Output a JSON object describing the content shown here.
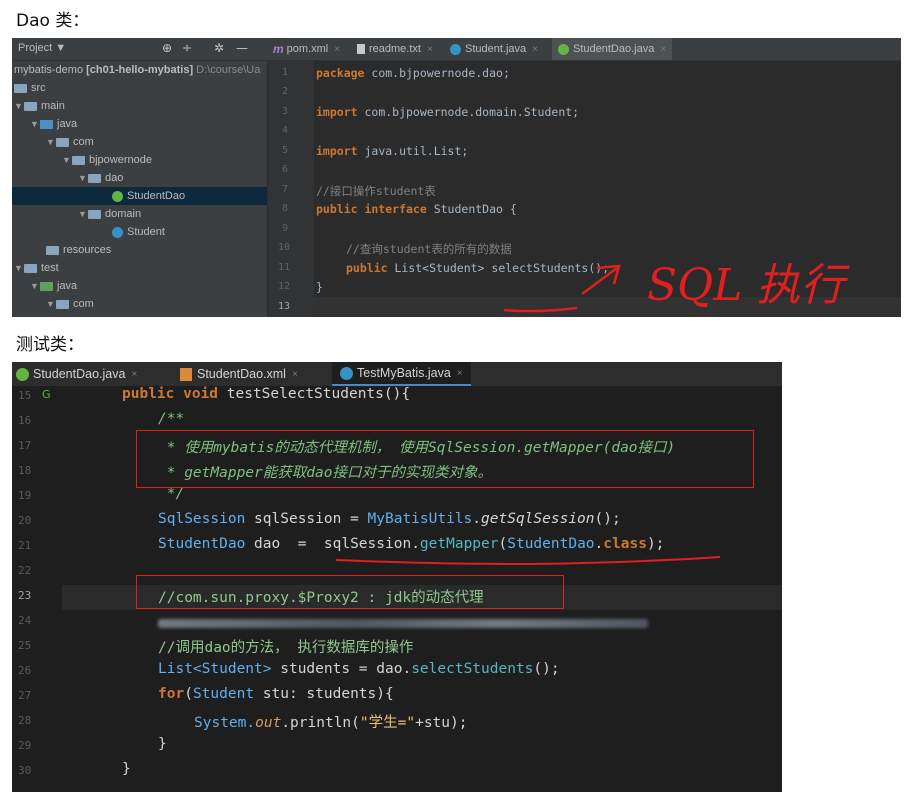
{
  "captions": {
    "dao": "Dao 类：",
    "test": "测试类："
  },
  "ide1": {
    "project_label": "Project ▼",
    "tabs": [
      {
        "label": "pom.xml",
        "icon": "m"
      },
      {
        "label": "readme.txt",
        "icon": "txt"
      },
      {
        "label": "Student.java",
        "icon": "class"
      },
      {
        "label": "StudentDao.java",
        "icon": "interface"
      }
    ],
    "tree": {
      "root": "mybatis-demo",
      "root_module": "[ch01-hello-mybatis]",
      "root_path": "D:\\course\\Ua",
      "items": [
        "src",
        "main",
        "java",
        "com",
        "bjpowernode",
        "dao",
        "StudentDao",
        "domain",
        "Student",
        "resources",
        "test",
        "java",
        "com"
      ]
    },
    "line_numbers": [
      "1",
      "2",
      "3",
      "4",
      "5",
      "6",
      "7",
      "8",
      "9",
      "10",
      "11",
      "12",
      "13"
    ],
    "code": {
      "l1_kw": "package",
      "l1_rest": " com.bjpowernode.dao;",
      "l3_kw": "import",
      "l3_rest": " com.bjpowernode.domain.Student;",
      "l5_kw": "import",
      "l5_rest": " java.util.List;",
      "l7_comment": "//接口操作student表",
      "l8_kw": "public interface",
      "l8_rest": " StudentDao {",
      "l10_comment": "//查询student表的所有的数据",
      "l11_kw": "public",
      "l11_type": " List<Student>",
      "l11_method": " selectStudents",
      "l11_end": "();",
      "l12": "}"
    },
    "annotation": "SQL 执行"
  },
  "ide2": {
    "tabs": [
      {
        "label": "StudentDao.java",
        "icon": "interface"
      },
      {
        "label": "StudentDao.xml",
        "icon": "xml"
      },
      {
        "label": "TestMyBatis.java",
        "icon": "test"
      }
    ],
    "line_numbers": [
      "15",
      "16",
      "17",
      "18",
      "19",
      "20",
      "21",
      "22",
      "23",
      "24",
      "25",
      "26",
      "27",
      "28",
      "29",
      "30"
    ],
    "code": {
      "l15_kw": "public void",
      "l15_rest": " testSelectStudents(){",
      "l16": "/**",
      "l17": " * 使用mybatis的动态代理机制， 使用SqlSession.getMapper(dao接口)",
      "l18": " * getMapper能获取dao接口对于的实现类对象。",
      "l19": " */",
      "l20_type": "SqlSession",
      "l20_a": " sqlSession = ",
      "l20_cls": "MyBatisUtils",
      "l20_dot": ".",
      "l20_m": "getSqlSession",
      "l20_end": "();",
      "l21_type": "StudentDao",
      "l21_a": " dao  =  ",
      "l21_b": "sqlSession.",
      "l21_m": "getMapper",
      "l21_c": "(",
      "l21_cls": "StudentDao",
      "l21_d": ".",
      "l21_kw": "class",
      "l21_end": ");",
      "l23_comment": "//com.sun.proxy.$Proxy2 : jdk的动态代理",
      "l25_comment": "//调用dao的方法， 执行数据库的操作",
      "l26_type": "List<Student>",
      "l26_a": " students = dao.",
      "l26_m": "selectStudents",
      "l26_end": "();",
      "l27_kw": "for",
      "l27_a": "(",
      "l27_type": "Student",
      "l27_b": " stu: students){",
      "l28_a": "System.",
      "l28_out": "out",
      "l28_b": ".println(",
      "l28_str": "\"学生=\"",
      "l28_c": "+stu);",
      "l29": "}",
      "l30": "}"
    }
  },
  "colors": {
    "red_annotation": "#e02020",
    "keyword": "#cc7832",
    "comment_green": "#7ec07e"
  }
}
